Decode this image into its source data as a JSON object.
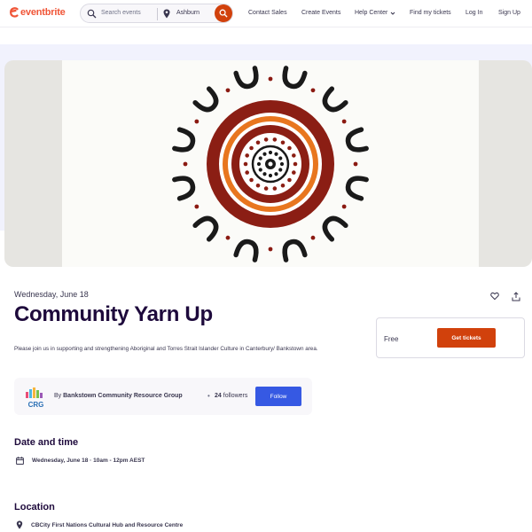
{
  "header": {
    "brand": "eventbrite",
    "search_placeholder": "Search events",
    "location": "Ashburn",
    "nav": {
      "contact_sales": "Contact Sales",
      "create_events": "Create Events",
      "help_center": "Help Center",
      "find_tickets": "Find my tickets",
      "log_in": "Log In",
      "sign_up": "Sign Up"
    }
  },
  "event": {
    "date": "Wednesday, June 18",
    "title": "Community Yarn Up",
    "description": "Please join us in supporting and strengthening Aboriginal and Torres Strait Islander Culture in Canterbury/ Bankstown area."
  },
  "tickets": {
    "price": "Free",
    "button": "Get tickets"
  },
  "organizer": {
    "by_label": "By",
    "name": "Bankstown Community Resource Group",
    "separator": "•",
    "followers_count": "24",
    "followers_label": "followers",
    "follow_button": "Follow",
    "logo_text": "CRG"
  },
  "date_and_time": {
    "heading": "Date and time",
    "value": "Wednesday, June 18 · 10am - 12pm AEST"
  },
  "location": {
    "heading": "Location",
    "venue": "CBCity First Nations Cultural Hub and Resource Centre"
  },
  "colors": {
    "brand": "#f05537",
    "cta": "#d1410c",
    "follow": "#3659e3",
    "heading": "#1e0a3c"
  }
}
